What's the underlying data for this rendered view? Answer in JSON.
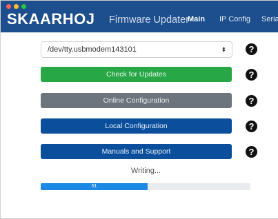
{
  "window": {
    "controls": [
      "close",
      "minimize",
      "zoom"
    ]
  },
  "header": {
    "brand": "SKAARHOJ",
    "app_title": "Firmware Updater",
    "nav": [
      {
        "label": "Main",
        "active": true
      },
      {
        "label": "IP Config",
        "active": false
      },
      {
        "label": "Serial",
        "active": false
      }
    ],
    "background_color": "#1d4f8e"
  },
  "main": {
    "port_select": {
      "value": "/dev/tty.usbmodem143101",
      "caret": "⬍"
    },
    "buttons": [
      {
        "label": "Check for Updates",
        "color": "#27a745",
        "help_icon": "?"
      },
      {
        "label": "Online Configuration",
        "color": "#6c757d",
        "help_icon": "?"
      },
      {
        "label": "Local Configuration",
        "color": "#0b4f9c",
        "help_icon": "?"
      },
      {
        "label": "Manuals and Support",
        "color": "#0b4f9c",
        "help_icon": "?"
      }
    ],
    "status_text": "Writing...",
    "progress": {
      "value": 51,
      "label": "51",
      "color": "#1e88e5"
    }
  }
}
